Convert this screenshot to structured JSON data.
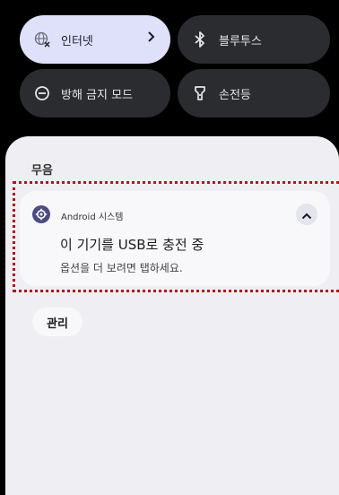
{
  "quick_settings": {
    "internet_label": "인터넷",
    "bluetooth_label": "블루투스",
    "dnd_label": "방해 금지 모드",
    "flashlight_label": "손전등"
  },
  "shade": {
    "section_label": "무음",
    "notification": {
      "app_name": "Android 시스템",
      "title": "이 기기를 USB로 충전 중",
      "body": "옵션을 더 보려면 탭하세요."
    },
    "manage_label": "관리"
  },
  "colors": {
    "active_tile": "#dfe1fb",
    "inactive_tile": "#2b2c30",
    "shade_bg": "#eeeef3",
    "highlight": "#b21616",
    "app_icon": "#4a4c83"
  }
}
